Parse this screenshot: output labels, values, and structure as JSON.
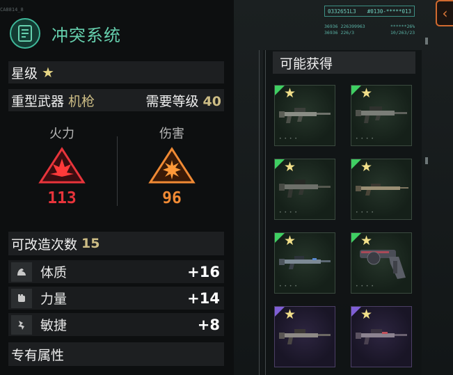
{
  "item": {
    "corner_code": "CA8814_8",
    "name": "冲突系统",
    "rarity_label": "星级",
    "rarity_star": "★",
    "weapon_class": "重型武器",
    "weapon_type": "机枪",
    "level_req_label": "需要等级",
    "level_req": "40"
  },
  "stats": [
    {
      "name": "火力",
      "value": "113",
      "color": "#e8343b",
      "icon": "firepower-icon"
    },
    {
      "name": "伤害",
      "value": "96",
      "color": "#f08a34",
      "icon": "damage-icon"
    }
  ],
  "mods": {
    "label": "可改造次数",
    "count": "15"
  },
  "attributes": [
    {
      "name": "体质",
      "value": "+16",
      "icon": "arm-flex-icon"
    },
    {
      "name": "力量",
      "value": "+14",
      "icon": "fist-icon"
    },
    {
      "name": "敏捷",
      "value": "+8",
      "icon": "runner-icon"
    }
  ],
  "exclusive": {
    "label": "专有属性"
  },
  "hud": {
    "code_left": "0332651L3",
    "code_right": "#0130-*****013",
    "line1_left": "36936 226399963",
    "line1_right": "******26%",
    "line2_left": "36936 226/3",
    "line2_right": "10/263/23"
  },
  "rewards": {
    "title": "可能获得",
    "items": [
      {
        "rarity": "green",
        "star": "★",
        "icon": "machine-gun-icon"
      },
      {
        "rarity": "green",
        "star": "★",
        "icon": "machine-gun-icon"
      },
      {
        "rarity": "green",
        "star": "★",
        "icon": "machine-gun-icon"
      },
      {
        "rarity": "green",
        "star": "★",
        "icon": "rifle-icon"
      },
      {
        "rarity": "green",
        "star": "★",
        "icon": "rifle-icon"
      },
      {
        "rarity": "green",
        "star": "★",
        "icon": "revolver-icon"
      },
      {
        "rarity": "purple",
        "star": "★",
        "icon": "machine-gun-icon"
      },
      {
        "rarity": "purple",
        "star": "★",
        "icon": "machine-gun-icon"
      }
    ]
  },
  "colors": {
    "accent_teal": "#66d0ae",
    "rarity_green": "#3fcf62",
    "rarity_purple": "#7f5fd6",
    "gold_text": "#cdbd85"
  }
}
